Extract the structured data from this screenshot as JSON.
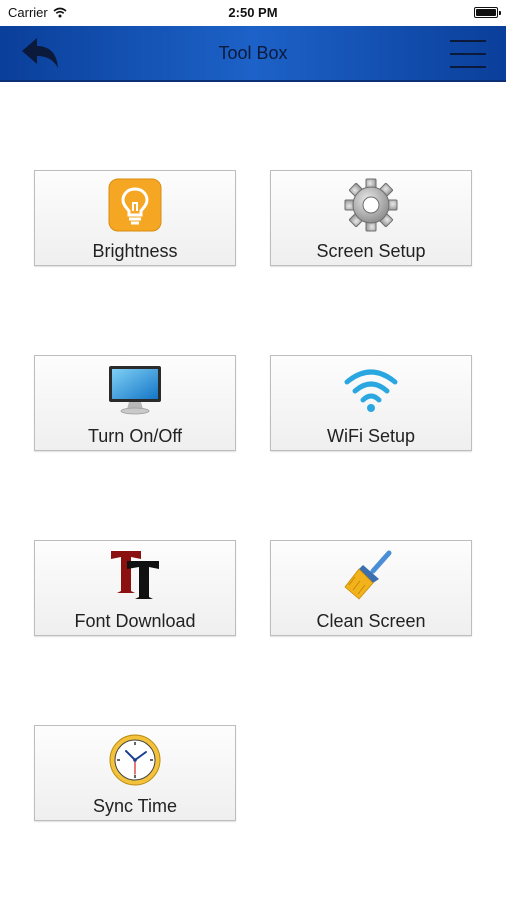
{
  "status_bar": {
    "carrier": "Carrier",
    "time": "2:50 PM"
  },
  "nav": {
    "title": "Tool Box",
    "back_icon": "back-arrow-icon",
    "menu_icon": "hamburger-menu-icon"
  },
  "tiles": [
    {
      "label": "Brightness",
      "icon": "lightbulb-icon"
    },
    {
      "label": "Screen Setup",
      "icon": "gear-icon"
    },
    {
      "label": "Turn On/Off",
      "icon": "monitor-icon"
    },
    {
      "label": "WiFi Setup",
      "icon": "wifi-icon"
    },
    {
      "label": "Font Download",
      "icon": "font-icon"
    },
    {
      "label": "Clean Screen",
      "icon": "broom-icon"
    },
    {
      "label": "Sync Time",
      "icon": "clock-icon"
    }
  ],
  "colors": {
    "nav_blue": "#1d62c8",
    "nav_dark_blue": "#0a3f9a",
    "brightness_orange": "#f5a623",
    "wifi_blue": "#2aa6e0"
  }
}
